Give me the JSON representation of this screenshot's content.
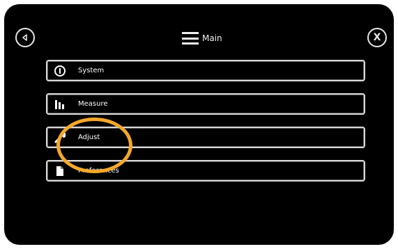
{
  "header": {
    "title": "Main",
    "back_icon": "back-arrow-icon",
    "close_label": "X"
  },
  "menu": {
    "items": [
      {
        "label": "System",
        "icon": "info-icon"
      },
      {
        "label": "Measure",
        "icon": "bar-chart-icon"
      },
      {
        "label": "Adjust",
        "icon": "wrench-icon"
      },
      {
        "label": "Preferences",
        "icon": "document-icon"
      }
    ]
  },
  "annotation": {
    "highlight_color": "#f4a82a"
  }
}
